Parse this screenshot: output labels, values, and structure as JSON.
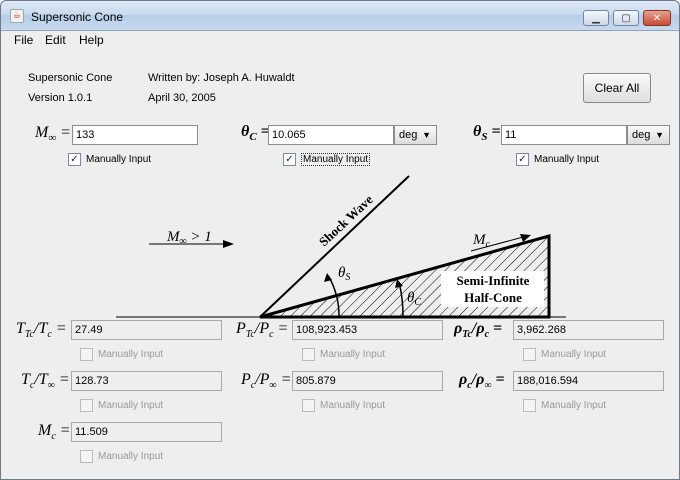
{
  "window": {
    "title": "Supersonic Cone"
  },
  "menu": [
    "File",
    "Edit",
    "Help"
  ],
  "header": {
    "app_name": "Supersonic Cone",
    "version": "Version 1.0.1",
    "author": "Written by:  Joseph A. Huwaldt",
    "date": "April 30, 2005",
    "clear_button": "Clear All"
  },
  "inputs": {
    "mach": {
      "value": "133",
      "checkbox": "Manually Input"
    },
    "theta_c": {
      "value": "10.065",
      "unit": "deg",
      "checkbox": "Manually Input"
    },
    "theta_s": {
      "value": "11",
      "unit": "deg",
      "checkbox": "Manually Input"
    }
  },
  "diagram": {
    "mach_label": "M",
    "shock_label": "Shock Wave",
    "cone_label_1": "Semi-Infinite",
    "cone_label_2": "Half-Cone",
    "mc_label": "M"
  },
  "outputs": {
    "ttc_tc": {
      "value": "27.49",
      "checkbox": "Manually Input"
    },
    "ptc_pc": {
      "value": "108,923.453",
      "checkbox": "Manually Input"
    },
    "rtc_rc": {
      "value": "3,962.268",
      "checkbox": "Manually Input"
    },
    "tc_tinf": {
      "value": "128.73",
      "checkbox": "Manually Input"
    },
    "pc_pinf": {
      "value": "805.879",
      "checkbox": "Manually Input"
    },
    "rc_rinf": {
      "value": "188,016.594",
      "checkbox": "Manually Input"
    },
    "mc": {
      "value": "11.509",
      "checkbox": "Manually Input"
    }
  }
}
